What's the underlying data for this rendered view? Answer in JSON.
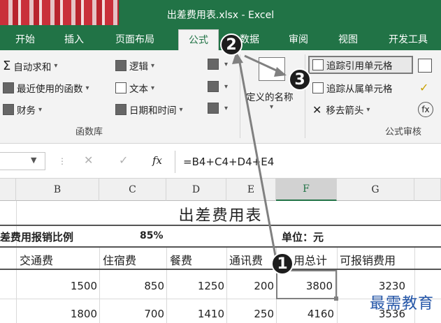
{
  "window": {
    "title": "出差费用表.xlsx - Excel"
  },
  "tabs": [
    {
      "label": "开始"
    },
    {
      "label": "插入"
    },
    {
      "label": "页面布局"
    },
    {
      "label": "公式"
    },
    {
      "label": "数据"
    },
    {
      "label": "审阅"
    },
    {
      "label": "视图"
    },
    {
      "label": "开发工具"
    }
  ],
  "ribbon": {
    "function_library": {
      "autosum": "自动求和",
      "recent": "最近使用的函数",
      "financial": "财务",
      "logical": "逻辑",
      "text": "文本",
      "datetime": "日期和时间",
      "group_label": "函数库"
    },
    "defined_names": {
      "label": "定义的名称"
    },
    "formula_auditing": {
      "trace_precedents": "追踪引用单元格",
      "trace_dependents": "追踪从属单元格",
      "remove_arrows": "移去箭头",
      "group_label": "公式审核"
    }
  },
  "formula_bar": {
    "cancel_icon": "✕",
    "enter_icon": "✓",
    "fx": "fx",
    "formula": "=B4+C4+D4+E4"
  },
  "columns": [
    "B",
    "C",
    "D",
    "E",
    "F",
    "G"
  ],
  "sheet": {
    "title": "出差费用表",
    "ratio_label": "差费用报销比例",
    "ratio_value": "85%",
    "unit_label": "单位：元",
    "headers": [
      "交通费",
      "住宿费",
      "餐费",
      "通讯费",
      "用总计",
      "可报销费用"
    ],
    "rows": [
      [
        "1500",
        "850",
        "1250",
        "200",
        "3800",
        "3230"
      ],
      [
        "1800",
        "700",
        "1410",
        "250",
        "4160",
        "3536"
      ]
    ]
  },
  "annotations": {
    "step1": "1",
    "step2": "2",
    "step3": "3"
  },
  "watermark": "最需教育",
  "colors": {
    "excel_green": "#217346",
    "arrow_gray": "#808080"
  }
}
